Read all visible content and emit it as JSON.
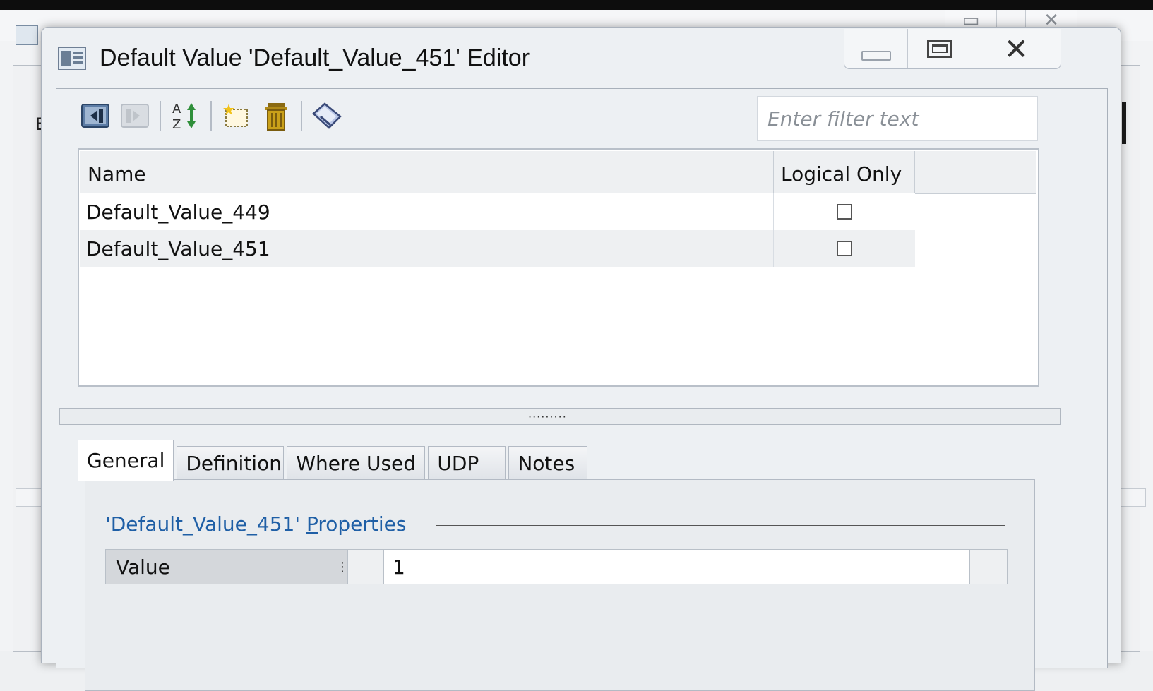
{
  "dialog": {
    "title": "Default Value 'Default_Value_451' Editor"
  },
  "toolbar": {
    "buttons": [
      {
        "icon": "collapse-left-icon"
      },
      {
        "icon": "expand-right-icon"
      },
      {
        "icon": "sort-az-icon"
      },
      {
        "icon": "new-item-icon"
      },
      {
        "icon": "delete-icon"
      },
      {
        "icon": "tag-icon"
      }
    ]
  },
  "filter": {
    "placeholder": "Enter filter text"
  },
  "grid": {
    "columns": [
      "Name",
      "Logical Only"
    ],
    "rows": [
      {
        "name": "Default_Value_449",
        "logical_only": false
      },
      {
        "name": "Default_Value_451",
        "logical_only": false
      }
    ]
  },
  "splitter": {
    "grip": "·········"
  },
  "tabs": [
    "General",
    "Definition",
    "Where Used",
    "UDP",
    "Notes"
  ],
  "active_tab": "General",
  "properties": {
    "title_prefix": "'Default_Value_451' ",
    "title_underlined": "P",
    "title_rest": "roperties",
    "row_label": "Value",
    "row_value": "1"
  },
  "background": {
    "letter": "E"
  },
  "colors": {
    "link_blue": "#1f5fa6",
    "delete_gold": "#c9a019"
  }
}
